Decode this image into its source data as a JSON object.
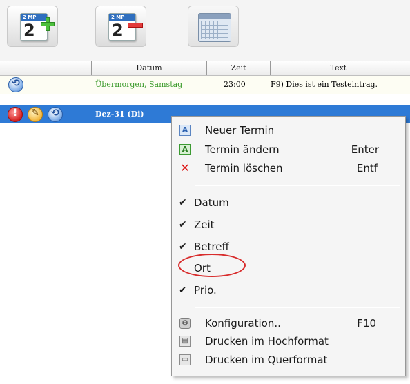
{
  "toolbar": {
    "buttons": [
      {
        "name": "new-appointment-button",
        "page_month": "2 MP",
        "page_day": "2",
        "icon": "calendar-plus-icon"
      },
      {
        "name": "delete-appointment-button",
        "page_month": "2 MP",
        "page_day": "2",
        "icon": "calendar-minus-icon"
      },
      {
        "name": "month-view-button",
        "icon": "calendar-grid-icon"
      }
    ]
  },
  "table": {
    "headers": [
      "Datum",
      "Zeit",
      "Text"
    ],
    "rows": [
      {
        "icons": [
          "sync-icon"
        ],
        "datum": "Übermorgen, Samstag",
        "zeit": "23:00",
        "text": "F9) Dies ist ein Testeintrag."
      },
      {
        "icons": [
          "alert-icon",
          "note-icon",
          "sync-icon"
        ],
        "datum": "Dez-31 (Di)",
        "zeit": "",
        "text": ""
      }
    ]
  },
  "context_menu": {
    "items": [
      {
        "label": "Neuer Termin",
        "shortcut": "",
        "icon": "new-appointment-icon"
      },
      {
        "label": "Termin ändern",
        "shortcut": "Enter",
        "icon": "edit-appointment-icon"
      },
      {
        "label": "Termin löschen",
        "shortcut": "Entf",
        "icon": "delete-icon"
      }
    ],
    "columns": [
      {
        "label": "Datum",
        "checked": true
      },
      {
        "label": "Zeit",
        "checked": true
      },
      {
        "label": "Betreff",
        "checked": true
      },
      {
        "label": "Ort",
        "checked": false
      },
      {
        "label": "Prio.",
        "checked": true
      }
    ],
    "actions": [
      {
        "label": "Konfiguration..",
        "shortcut": "F10",
        "icon": "settings-icon"
      },
      {
        "label": "Drucken im Hochformat",
        "shortcut": "",
        "icon": "print-portrait-icon"
      },
      {
        "label": "Drucken im Querformat",
        "shortcut": "",
        "icon": "print-landscape-icon"
      }
    ],
    "check_glyph": "✔"
  },
  "colors": {
    "selection": "#2e7ad6",
    "date_green": "#3a9a2a",
    "highlight_circle": "#d82c2c"
  }
}
